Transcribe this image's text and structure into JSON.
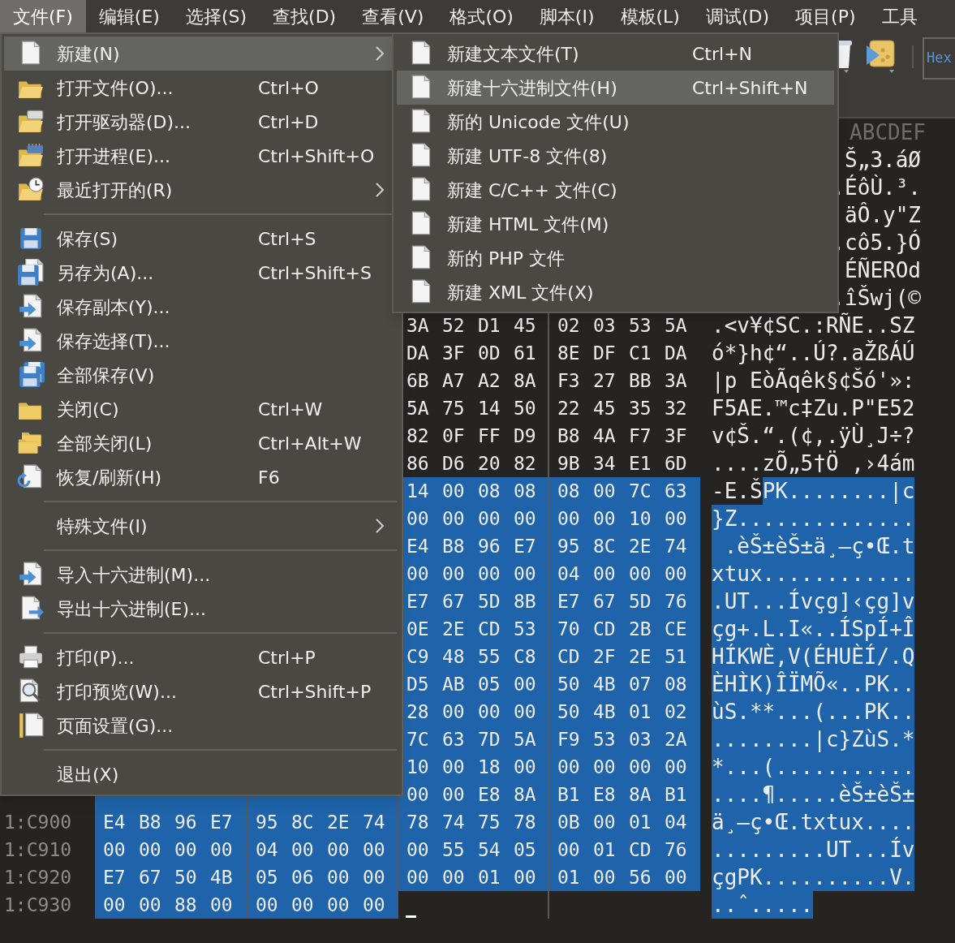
{
  "menubar": [
    {
      "label": "文件(F)",
      "selected": true
    },
    {
      "label": "编辑(E)",
      "selected": false
    },
    {
      "label": "选择(S)",
      "selected": false
    },
    {
      "label": "查找(D)",
      "selected": false
    },
    {
      "label": "查看(V)",
      "selected": false
    },
    {
      "label": "格式(O)",
      "selected": false
    },
    {
      "label": "脚本(I)",
      "selected": false
    },
    {
      "label": "模板(L)",
      "selected": false
    },
    {
      "label": "调试(D)",
      "selected": false
    },
    {
      "label": "项目(P)",
      "selected": false
    },
    {
      "label": "工具",
      "selected": false
    }
  ],
  "toolbar": {
    "view_mode": "Hex"
  },
  "file_menu": {
    "items": [
      {
        "kind": "item",
        "label": "新建(N)",
        "submenu": true,
        "selected": true
      },
      {
        "kind": "item",
        "label": "打开文件(O)...",
        "shortcut": "Ctrl+O",
        "submenu": false,
        "selected": false
      },
      {
        "kind": "item",
        "label": "打开驱动器(D)...",
        "shortcut": "Ctrl+D",
        "submenu": false,
        "selected": false
      },
      {
        "kind": "item",
        "label": "打开进程(E)...",
        "shortcut": "Ctrl+Shift+O",
        "submenu": false,
        "selected": false
      },
      {
        "kind": "item",
        "label": "最近打开的(R)",
        "submenu": true,
        "selected": false
      },
      {
        "kind": "separator"
      },
      {
        "kind": "item",
        "label": "保存(S)",
        "shortcut": "Ctrl+S",
        "submenu": false,
        "selected": false
      },
      {
        "kind": "item",
        "label": "另存为(A)...",
        "shortcut": "Ctrl+Shift+S",
        "submenu": false,
        "selected": false
      },
      {
        "kind": "item",
        "label": "保存副本(Y)...",
        "submenu": false,
        "selected": false
      },
      {
        "kind": "item",
        "label": "保存选择(T)...",
        "submenu": false,
        "selected": false
      },
      {
        "kind": "item",
        "label": "全部保存(V)",
        "submenu": false,
        "selected": false
      },
      {
        "kind": "item",
        "label": "关闭(C)",
        "shortcut": "Ctrl+W",
        "submenu": false,
        "selected": false
      },
      {
        "kind": "item",
        "label": "全部关闭(L)",
        "shortcut": "Ctrl+Alt+W",
        "submenu": false,
        "selected": false
      },
      {
        "kind": "item",
        "label": "恢复/刷新(H)",
        "shortcut": "F6",
        "submenu": false,
        "selected": false
      },
      {
        "kind": "separator"
      },
      {
        "kind": "item",
        "label": "特殊文件(I)",
        "submenu": true,
        "selected": false
      },
      {
        "kind": "separator"
      },
      {
        "kind": "item",
        "label": "导入十六进制(M)...",
        "submenu": false,
        "selected": false
      },
      {
        "kind": "item",
        "label": "导出十六进制(E)...",
        "submenu": false,
        "selected": false
      },
      {
        "kind": "separator"
      },
      {
        "kind": "item",
        "label": "打印(P)...",
        "shortcut": "Ctrl+P",
        "submenu": false,
        "selected": false
      },
      {
        "kind": "item",
        "label": "打印预览(W)...",
        "shortcut": "Ctrl+Shift+P",
        "submenu": false,
        "selected": false
      },
      {
        "kind": "item",
        "label": "页面设置(G)...",
        "submenu": false,
        "selected": false
      },
      {
        "kind": "separator"
      },
      {
        "kind": "item",
        "label": "退出(X)",
        "submenu": false,
        "selected": false
      }
    ]
  },
  "new_submenu": {
    "items": [
      {
        "label": "新建文本文件(T)",
        "shortcut": "Ctrl+N",
        "selected": false
      },
      {
        "label": "新建十六进制文件(H)",
        "shortcut": "Ctrl+Shift+N",
        "selected": true
      },
      {
        "label": "新的 Unicode 文件(U)",
        "selected": false
      },
      {
        "label": "新建 UTF-8 文件(8)",
        "selected": false
      },
      {
        "label": "新建 C/C++ 文件(C)",
        "selected": false
      },
      {
        "label": "新建 HTML 文件(M)",
        "selected": false
      },
      {
        "label": "新的 PHP 文件",
        "selected": false
      },
      {
        "label": "新建 XML 文件(X)",
        "selected": false
      }
    ]
  },
  "hex_view": {
    "header_text": "ABCDEF",
    "rows": [
      {
        "text": [
          {
            "value": "Š„3.áØ",
            "selected": false
          }
        ]
      },
      {
        "text": [
          {
            "value": ".ÉôÙ.³.",
            "selected": false
          }
        ]
      },
      {
        "text": [
          {
            "value": "äÔ.y\"Z",
            "selected": false
          }
        ]
      },
      {
        "text": [
          {
            "value": ".cô5.}Ó",
            "selected": false
          }
        ]
      },
      {
        "text": [
          {
            "value": "ÉÑEROd",
            "selected": false
          }
        ]
      },
      {
        "text": [
          {
            "value": ".îŠwj(©",
            "selected": false
          }
        ]
      },
      {
        "group_3": {
          "bytes": [
            "3A",
            "52",
            "D1",
            "45"
          ],
          "selected": false
        },
        "group_4": {
          "bytes": [
            "02",
            "03",
            "53",
            "5A"
          ],
          "selected": false
        },
        "text": [
          {
            "value": ".<v¥¢SC.:RÑE..SZ",
            "selected": false
          }
        ]
      },
      {
        "group_3": {
          "bytes": [
            "DA",
            "3F",
            "0D",
            "61"
          ],
          "selected": false
        },
        "group_4": {
          "bytes": [
            "8E",
            "DF",
            "C1",
            "DA"
          ],
          "selected": false
        },
        "text": [
          {
            "value": "ó*}h¢“..Ú?.aŽßÁÚ",
            "selected": false
          }
        ]
      },
      {
        "group_3": {
          "bytes": [
            "6B",
            "A7",
            "A2",
            "8A"
          ],
          "selected": false
        },
        "group_4": {
          "bytes": [
            "F3",
            "27",
            "BB",
            "3A"
          ],
          "selected": false
        },
        "text": [
          {
            "value": "|p EòÃqêk§¢Šó'»:",
            "selected": false
          }
        ]
      },
      {
        "group_3": {
          "bytes": [
            "5A",
            "75",
            "14",
            "50"
          ],
          "selected": false
        },
        "group_4": {
          "bytes": [
            "22",
            "45",
            "35",
            "32"
          ],
          "selected": false
        },
        "text": [
          {
            "value": "F5AE.™c‡Zu.P\"E52",
            "selected": false
          }
        ]
      },
      {
        "group_3": {
          "bytes": [
            "82",
            "0F",
            "FF",
            "D9"
          ],
          "selected": false
        },
        "group_4": {
          "bytes": [
            "B8",
            "4A",
            "F7",
            "3F"
          ],
          "selected": false
        },
        "text": [
          {
            "value": "v¢Š.“.(¢,.ÿÙ¸J÷?",
            "selected": false
          }
        ]
      },
      {
        "group_3": {
          "bytes": [
            "86",
            "D6",
            "20",
            "82"
          ],
          "selected": false
        },
        "group_4": {
          "bytes": [
            "9B",
            "34",
            "E1",
            "6D"
          ],
          "selected": false
        },
        "text": [
          {
            "value": "....zÕ„5†Ö ‚›4ám",
            "selected": false
          }
        ]
      },
      {
        "group_3": {
          "bytes": [
            "14",
            "00",
            "08",
            "08"
          ],
          "selected": true
        },
        "group_4": {
          "bytes": [
            "08",
            "00",
            "7C",
            "63"
          ],
          "selected": true
        },
        "text": [
          {
            "value": "-E.Š",
            "selected": false
          },
          {
            "value": "PK........|c",
            "selected": true
          }
        ]
      },
      {
        "group_3": {
          "bytes": [
            "00",
            "00",
            "00",
            "00"
          ],
          "selected": true
        },
        "group_4": {
          "bytes": [
            "00",
            "00",
            "10",
            "00"
          ],
          "selected": true
        },
        "text": [
          {
            "value": "}Z..............",
            "selected": true
          }
        ]
      },
      {
        "group_3": {
          "bytes": [
            "E4",
            "B8",
            "96",
            "E7"
          ],
          "selected": true
        },
        "group_4": {
          "bytes": [
            "95",
            "8C",
            "2E",
            "74"
          ],
          "selected": true
        },
        "text": [
          {
            "value": " .èŠ±èŠ±ä¸–ç•Œ.t",
            "selected": true
          }
        ]
      },
      {
        "group_3": {
          "bytes": [
            "00",
            "00",
            "00",
            "00"
          ],
          "selected": true
        },
        "group_4": {
          "bytes": [
            "04",
            "00",
            "00",
            "00"
          ],
          "selected": true
        },
        "text": [
          {
            "value": "xtux............",
            "selected": true
          }
        ]
      },
      {
        "group_3": {
          "bytes": [
            "E7",
            "67",
            "5D",
            "8B"
          ],
          "selected": true
        },
        "group_4": {
          "bytes": [
            "E7",
            "67",
            "5D",
            "76"
          ],
          "selected": true
        },
        "text": [
          {
            "value": ".UT...Ívçg]‹çg]v",
            "selected": true
          }
        ]
      },
      {
        "group_3": {
          "bytes": [
            "0E",
            "2E",
            "CD",
            "53"
          ],
          "selected": true
        },
        "group_4": {
          "bytes": [
            "70",
            "CD",
            "2B",
            "CE"
          ],
          "selected": true
        },
        "text": [
          {
            "value": "çg+.L.I«..ÍSpÍ+Î",
            "selected": true
          }
        ]
      },
      {
        "group_3": {
          "bytes": [
            "C9",
            "48",
            "55",
            "C8"
          ],
          "selected": true
        },
        "group_4": {
          "bytes": [
            "CD",
            "2F",
            "2E",
            "51"
          ],
          "selected": true
        },
        "text": [
          {
            "value": "HÍKWÈ,V(ÉHUÈÍ/.Q",
            "selected": true
          }
        ]
      },
      {
        "group_3": {
          "bytes": [
            "D5",
            "AB",
            "05",
            "00"
          ],
          "selected": true
        },
        "group_4": {
          "bytes": [
            "50",
            "4B",
            "07",
            "08"
          ],
          "selected": true
        },
        "text": [
          {
            "value": "ÈHÌK)ÎÏMÕ«..PK..",
            "selected": true
          }
        ]
      },
      {
        "group_3": {
          "bytes": [
            "28",
            "00",
            "00",
            "00"
          ],
          "selected": true
        },
        "group_4": {
          "bytes": [
            "50",
            "4B",
            "01",
            "02"
          ],
          "selected": true
        },
        "text": [
          {
            "value": "ùS.**...(...PK..",
            "selected": true
          }
        ]
      },
      {
        "group_3": {
          "bytes": [
            "7C",
            "63",
            "7D",
            "5A"
          ],
          "selected": true
        },
        "group_4": {
          "bytes": [
            "F9",
            "53",
            "03",
            "2A"
          ],
          "selected": true
        },
        "text": [
          {
            "value": "........|c}ZùS.*",
            "selected": true
          }
        ]
      },
      {
        "group_3": {
          "bytes": [
            "10",
            "00",
            "18",
            "00"
          ],
          "selected": true
        },
        "group_4": {
          "bytes": [
            "00",
            "00",
            "00",
            "00"
          ],
          "selected": true
        },
        "text": [
          {
            "value": "*...(...........",
            "selected": true
          }
        ]
      },
      {
        "group_1": {
          "selected": true
        },
        "group_2": {
          "selected": true
        },
        "group_3": {
          "bytes": [
            "00",
            "00",
            "E8",
            "8A"
          ],
          "selected": true
        },
        "group_4": {
          "bytes": [
            "B1",
            "E8",
            "8A",
            "B1"
          ],
          "selected": true
        },
        "text": [
          {
            "value": "....¶.....èŠ±èŠ±",
            "selected": true
          }
        ]
      },
      {
        "address": "1:C900",
        "group_1": {
          "bytes": [
            "E4",
            "B8",
            "96",
            "E7"
          ],
          "selected": true
        },
        "group_2": {
          "bytes": [
            "95",
            "8C",
            "2E",
            "74"
          ],
          "selected": true
        },
        "group_3": {
          "bytes": [
            "78",
            "74",
            "75",
            "78"
          ],
          "selected": true
        },
        "group_4": {
          "bytes": [
            "0B",
            "00",
            "01",
            "04"
          ],
          "selected": true
        },
        "text": [
          {
            "value": "ä¸–ç•Œ.txtux....",
            "selected": true
          }
        ]
      },
      {
        "address": "1:C910",
        "group_1": {
          "bytes": [
            "00",
            "00",
            "00",
            "00"
          ],
          "selected": true
        },
        "group_2": {
          "bytes": [
            "04",
            "00",
            "00",
            "00"
          ],
          "selected": true
        },
        "group_3": {
          "bytes": [
            "00",
            "55",
            "54",
            "05"
          ],
          "selected": true
        },
        "group_4": {
          "bytes": [
            "00",
            "01",
            "CD",
            "76"
          ],
          "selected": true
        },
        "text": [
          {
            "value": ".........UT...Ív",
            "selected": true
          }
        ]
      },
      {
        "address": "1:C920",
        "group_1": {
          "bytes": [
            "E7",
            "67",
            "50",
            "4B"
          ],
          "selected": true
        },
        "group_2": {
          "bytes": [
            "05",
            "06",
            "00",
            "00"
          ],
          "selected": true
        },
        "group_3": {
          "bytes": [
            "00",
            "00",
            "01",
            "00"
          ],
          "selected": true
        },
        "group_4": {
          "bytes": [
            "01",
            "00",
            "56",
            "00"
          ],
          "selected": true
        },
        "text": [
          {
            "value": "çgPK..........V.",
            "selected": true
          }
        ]
      },
      {
        "address": "1:C930",
        "group_1": {
          "bytes": [
            "00",
            "00",
            "88",
            "00"
          ],
          "selected": true
        },
        "group_2": {
          "bytes": [
            "00",
            "00",
            "00",
            "00"
          ],
          "selected": true
        },
        "text": [
          {
            "value": "..ˆ.....",
            "selected": true
          }
        ]
      }
    ]
  }
}
